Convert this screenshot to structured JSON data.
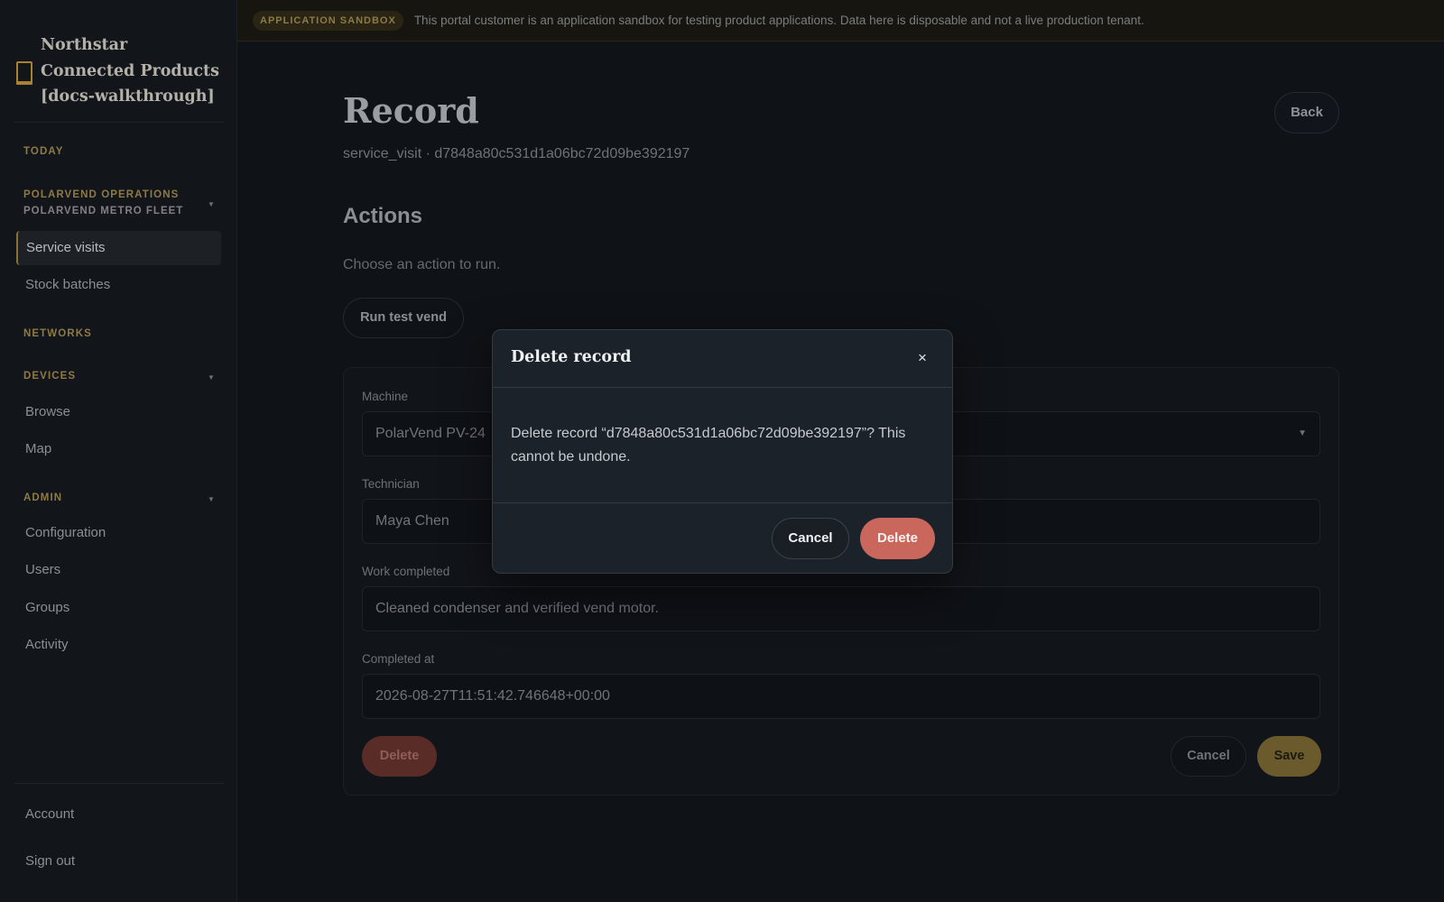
{
  "banner": {
    "badge": "APPLICATION SANDBOX",
    "text": "This portal customer is an application sandbox for testing product applications. Data here is disposable and not a live production tenant."
  },
  "sidebar": {
    "brand": "Northstar Connected Products [docs-walkthrough]",
    "sections": {
      "today": "TODAY",
      "polarvend_ops": "POLARVEND OPERATIONS",
      "polarvend_fleet": "POLARVEND METRO FLEET",
      "networks": "NETWORKS",
      "devices": "DEVICES",
      "admin": "ADMIN"
    },
    "items": {
      "service_visits": "Service visits",
      "stock_batches": "Stock batches",
      "browse": "Browse",
      "map": "Map",
      "configuration": "Configuration",
      "users": "Users",
      "groups": "Groups",
      "activity": "Activity"
    },
    "bottom": {
      "account": "Account",
      "sign_out": "Sign out"
    }
  },
  "main": {
    "title": "Record",
    "subtitle": "service_visit · d7848a80c531d1a06bc72d09be392197",
    "back_label": "Back",
    "actions_title": "Actions",
    "actions_desc": "Choose an action to run.",
    "run_test_vend": "Run test vend",
    "form": {
      "machine_label": "Machine",
      "machine_value": "PolarVend PV-24",
      "technician_label": "Technician",
      "technician_value": "Maya Chen",
      "work_label": "Work completed",
      "work_value": "Cleaned condenser and verified vend motor.",
      "completed_label": "Completed at",
      "completed_value": "2026-08-27T11:51:42.746648+00:00",
      "delete_label": "Delete",
      "cancel_label": "Cancel",
      "save_label": "Save"
    }
  },
  "modal": {
    "title": "Delete record",
    "close_glyph": "×",
    "body": "Delete record “d7848a80c531d1a06bc72d09be392197”? This cannot be undone.",
    "cancel_label": "Cancel",
    "delete_label": "Delete"
  },
  "colors": {
    "accent_gold": "#a8822f",
    "danger": "#c9675c",
    "background": "#0f1216"
  },
  "icons": {
    "brand": "door-icon",
    "close": "close-icon",
    "caret": "chevron-down-icon"
  }
}
